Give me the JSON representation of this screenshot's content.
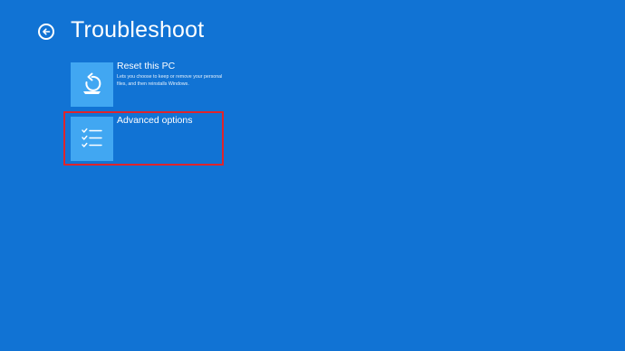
{
  "header": {
    "title": "Troubleshoot",
    "back_icon": "back-arrow-icon"
  },
  "options": [
    {
      "label": "Reset this PC",
      "description": "Lets you choose to keep or remove your personal files, and then reinstalls Windows.",
      "icon": "reset-pc-icon"
    },
    {
      "label": "Advanced options",
      "description": "",
      "icon": "checklist-icon",
      "highlighted": true
    }
  ],
  "colors": {
    "background": "#1173d4",
    "tile": "#41a7f2",
    "highlight": "#e0242b"
  }
}
